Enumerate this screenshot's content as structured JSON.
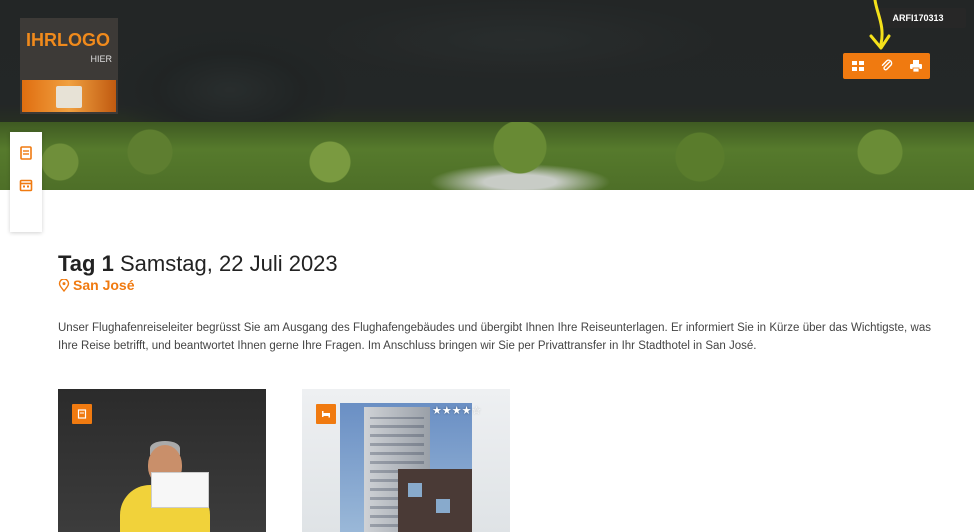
{
  "header": {
    "logo_main": "IHRLOGO",
    "logo_sub": "HIER",
    "reference_code": "ARFI170313",
    "buttons": [
      {
        "icon": "grid-icon"
      },
      {
        "icon": "paperclip-icon"
      },
      {
        "icon": "printer-icon"
      }
    ],
    "accent_color": "#f07a10",
    "annotation_arrow_color": "#f5e11a"
  },
  "sidebar": {
    "items": [
      {
        "icon": "book-icon"
      },
      {
        "icon": "calendar-icon"
      }
    ]
  },
  "day": {
    "label": "Tag 1",
    "date": "Samstag, 22 Juli 2023",
    "location": "San José",
    "description": "Unser Flughafenreiseleiter begrüsst Sie am Ausgang des Flughafengebäudes und übergibt Ihnen Ihre Reiseunterlagen. Er informiert Sie in Kürze über das Wichtigste, was Ihre Reise betrifft, und beantwortet Ihnen gerne Ihre Fragen. Im Anschluss bringen wir Sie per Privattransfer in Ihr Stadthotel in San José."
  },
  "cards": [
    {
      "type": "transfer",
      "badge_icon": "document-icon"
    },
    {
      "type": "hotel",
      "badge_icon": "bed-icon",
      "rating": 4,
      "rating_max": 5,
      "stars_display": "★★★★☆"
    }
  ]
}
